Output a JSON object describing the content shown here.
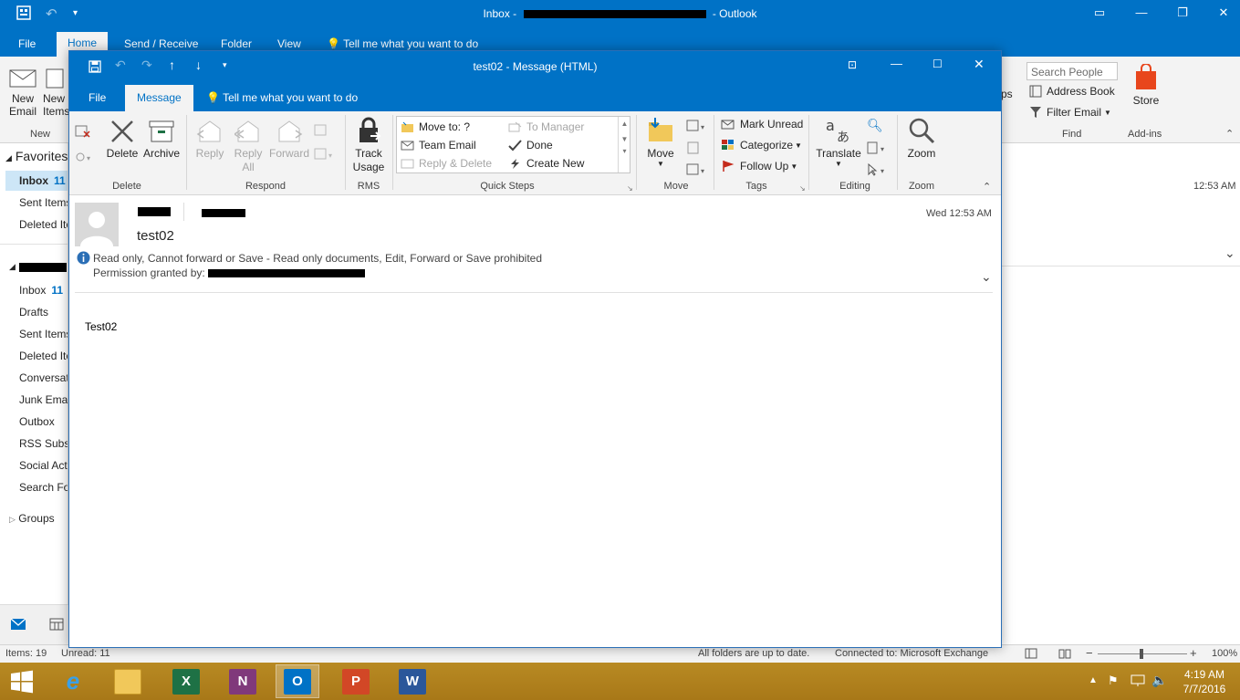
{
  "main_window": {
    "title_prefix": "Inbox - ",
    "title_suffix": " - Outlook",
    "menu_tabs": [
      "File",
      "Home",
      "Send / Receive",
      "Folder",
      "View"
    ],
    "tell_me": "Tell me what you want to do",
    "search_people_placeholder": "Search People",
    "address_book": "Address Book",
    "filter_email": "Filter Email",
    "find_label": "Find",
    "store_label": "Store",
    "addins_label": "Add-ins",
    "new_email": [
      "New",
      "Email"
    ],
    "new_items": [
      "New",
      "Items"
    ],
    "new_group_label": "New",
    "apps_fragment": "ps",
    "reading_time": "12:53 AM"
  },
  "nav": {
    "favorites": "Favorites",
    "fav_items": [
      {
        "label": "Inbox",
        "count": "11"
      },
      {
        "label": "Sent Items",
        "count": ""
      },
      {
        "label": "Deleted Items",
        "count": ""
      }
    ],
    "folders": [
      {
        "label": "Inbox",
        "count": "11"
      },
      {
        "label": "Drafts",
        "count": ""
      },
      {
        "label": "Sent Items",
        "count": ""
      },
      {
        "label": "Deleted Items",
        "count": ""
      },
      {
        "label": "Conversation History",
        "count": ""
      },
      {
        "label": "Junk Email",
        "count": ""
      },
      {
        "label": "Outbox",
        "count": ""
      },
      {
        "label": "RSS Subscriptions",
        "count": ""
      },
      {
        "label": "Social Activity Notifications",
        "count": ""
      },
      {
        "label": "Search Folders",
        "count": ""
      }
    ],
    "groups": "Groups"
  },
  "status": {
    "items": "Items: 19",
    "unread": "Unread: 11",
    "sync": "All folders are up to date.",
    "connection": "Connected to: Microsoft Exchange",
    "zoom": "100%"
  },
  "taskbar": {
    "time": "4:19 AM",
    "date": "7/7/2016"
  },
  "message_window": {
    "title": "test02 - Message (HTML)",
    "tabs": {
      "file": "File",
      "message": "Message"
    },
    "tell_me": "Tell me what you want to do",
    "ribbon": {
      "delete": "Delete",
      "archive": "Archive",
      "delete_group": "Delete",
      "reply": "Reply",
      "reply_all": [
        "Reply",
        "All"
      ],
      "forward": "Forward",
      "respond_group": "Respond",
      "track_usage": [
        "Track",
        "Usage"
      ],
      "rms_group": "RMS",
      "quick_steps": [
        "Move to: ?",
        "Team Email",
        "Reply & Delete",
        "To Manager",
        "Done",
        "Create New"
      ],
      "quick_steps_group": "Quick Steps",
      "move": "Move",
      "move_group": "Move",
      "mark_unread": "Mark Unread",
      "categorize": "Categorize",
      "follow_up": "Follow Up",
      "tags_group": "Tags",
      "translate": "Translate",
      "editing_group": "Editing",
      "zoom": "Zoom",
      "zoom_group": "Zoom"
    },
    "header": {
      "subject": "test02",
      "date": "Wed 12:53 AM",
      "permission_line": "Read only, Cannot forward or Save - Read only documents, Edit, Forward or Save prohibited",
      "permission_granted": "Permission granted by:"
    },
    "body": "Test02"
  }
}
